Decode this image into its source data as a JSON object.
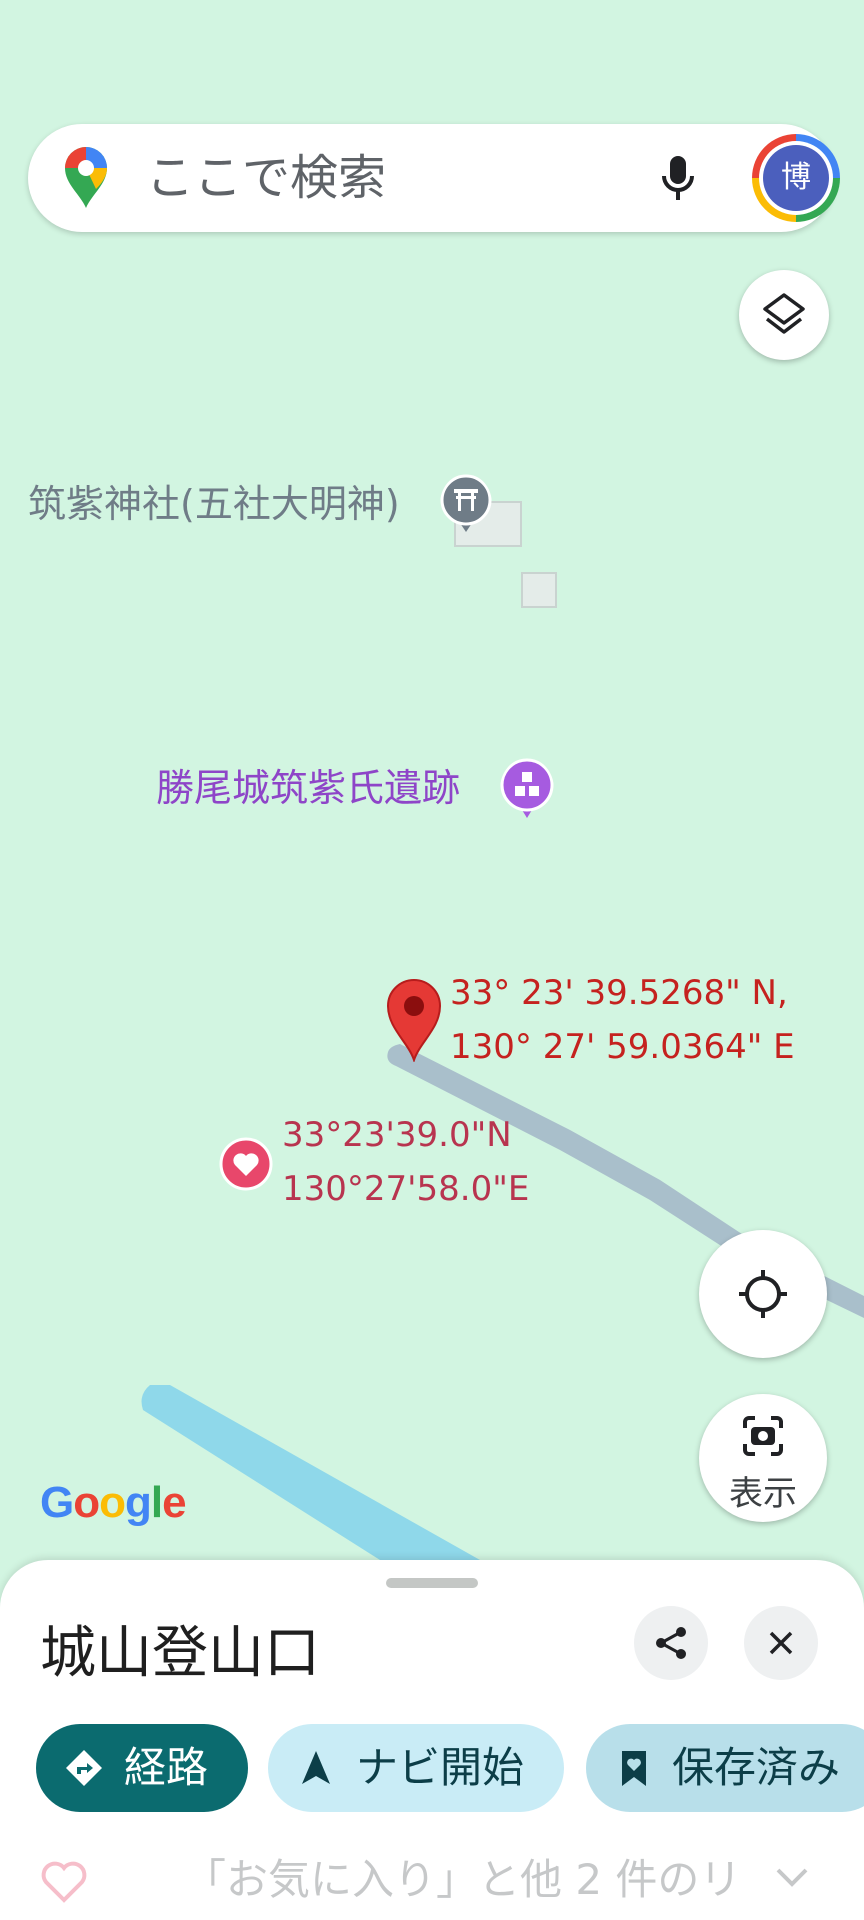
{
  "search": {
    "placeholder": "ここで検索",
    "avatar_initial": "博"
  },
  "map": {
    "poi_shrine": "筑紫神社(五社大明神)",
    "poi_ruins": "勝尾城筑紫氏遺跡",
    "dropped_pin_coords": "33° 23' 39.5268\" N,\n130° 27' 59.0364\" E",
    "saved_place_coords": "33°23'39.0\"N\n130°27'58.0\"E",
    "attribution": "Google",
    "lens_label": "表示"
  },
  "sheet": {
    "title": "城山登山口",
    "chips": {
      "route": "経路",
      "navigate": "ナビ開始",
      "saved": "保存済み"
    },
    "saved_lists_text": "「お気に入り」と他 2 件のリ"
  },
  "colors": {
    "map_bg": "#d2f5e1",
    "route_chip": "#0b6b6f",
    "nav_chip": "#c9ecf6",
    "pin_red": "#e53935",
    "heart_pink": "#e8476b",
    "poi_purple": "#8e45c8",
    "water": "#8fd8ea"
  },
  "icons": [
    "maps-logo-icon",
    "mic-icon",
    "layers-icon",
    "my-location-icon",
    "lens-icon",
    "torii-icon",
    "ruins-icon",
    "red-pin-icon",
    "heart-icon",
    "share-icon",
    "close-icon",
    "directions-icon",
    "navigation-arrow-icon",
    "bookmark-icon",
    "chevron-down-icon"
  ]
}
